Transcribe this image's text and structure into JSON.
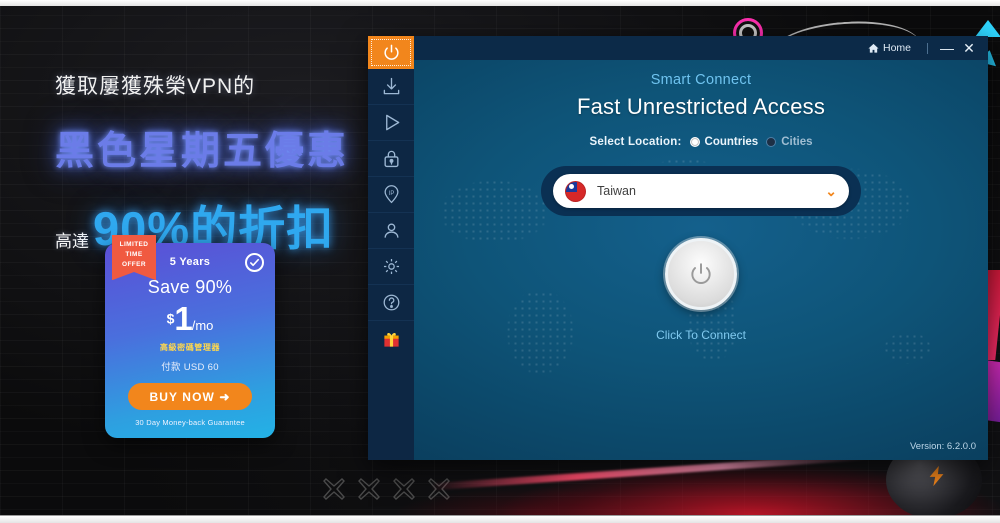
{
  "promo": {
    "line1": "獲取屢獲殊榮VPN的",
    "line2": "黑色星期五優惠",
    "line3_small": "高達",
    "line3_big": "90%的折扣"
  },
  "price_card": {
    "ribbon_line1": "LIMITED",
    "ribbon_line2": "TIME",
    "ribbon_line3": "OFFER",
    "term": "5 Years",
    "save": "Save 90%",
    "currency": "$",
    "amount": "1",
    "per": "/mo",
    "bonus_cn": "高級密碼管理器",
    "billed": "付款 USD 60",
    "buy_label": "BUY NOW  ➜",
    "guarantee": "30 Day Money-back Guarantee"
  },
  "app": {
    "titlebar": {
      "home": "Home",
      "minimize": "—",
      "close": "✕"
    },
    "sidebar": [
      {
        "name": "power",
        "icon": "power-icon",
        "active": true
      },
      {
        "name": "download",
        "icon": "download-icon",
        "active": false
      },
      {
        "name": "play",
        "icon": "play-icon",
        "active": false
      },
      {
        "name": "lock",
        "icon": "lock-icon",
        "active": false
      },
      {
        "name": "ip",
        "icon": "ip-pin-icon",
        "active": false
      },
      {
        "name": "account",
        "icon": "user-icon",
        "active": false
      },
      {
        "name": "settings",
        "icon": "gear-icon",
        "active": false
      },
      {
        "name": "help",
        "icon": "question-icon",
        "active": false
      },
      {
        "name": "gift",
        "icon": "gift-icon",
        "active": false
      }
    ],
    "smart_connect": "Smart Connect",
    "headline": "Fast Unrestricted Access",
    "select_label": "Select Location:",
    "option_countries": "Countries",
    "option_cities": "Cities",
    "selected_option": "Countries",
    "location": "Taiwan",
    "connect_label": "Click To Connect",
    "version": "Version: 6.2.0.0"
  },
  "colors": {
    "accent_orange": "#f2861c",
    "app_blue": "#0e5075",
    "sidebar_blue": "#0d2744",
    "titlebar_blue": "#0c2a48",
    "link_blue": "#6fc3ef",
    "promo_purple": "#6b7ce8",
    "promo_cyan": "#2fa8ef"
  }
}
